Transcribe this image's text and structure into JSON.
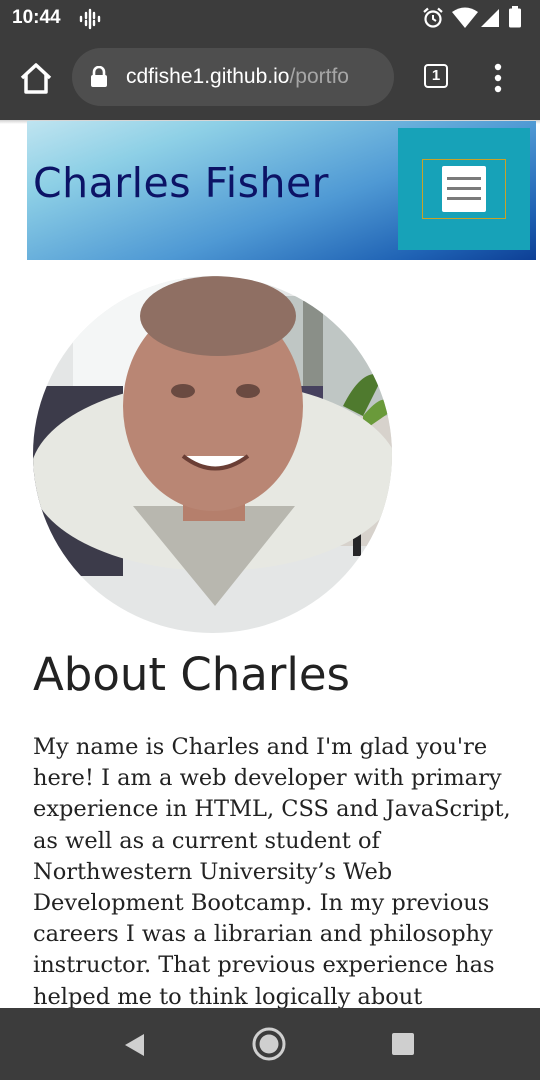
{
  "status_bar": {
    "time": "10:44",
    "icons": [
      "podcast-icon",
      "alarm-icon",
      "wifi-icon",
      "signal-icon",
      "battery-icon"
    ]
  },
  "browser": {
    "url_domain": "cdfishe1.github.io",
    "url_path": "/portfo",
    "tab_count": "1",
    "icons": [
      "home-icon",
      "lock-icon",
      "more-vert-icon"
    ]
  },
  "site": {
    "title": "Charles Fisher",
    "nav_toggle_icon": "hamburger-icon",
    "colors": {
      "title": "#0c1366",
      "toggle_bg": "#17a2b8",
      "toggle_border": "#c9a227"
    }
  },
  "about": {
    "heading": "About Charles",
    "paragraph": "My name is Charles and I'm glad you're here! I am a web developer with primary experience in HTML, CSS and JavaScript, as well as a current student of Northwestern University’s Web Development Bootcamp. In my previous careers I was a librarian and philosophy instructor. That previous experience has helped me to think logically about"
  },
  "nav_bar": {
    "icons": [
      "back-icon",
      "home-circle-icon",
      "recents-icon"
    ]
  }
}
